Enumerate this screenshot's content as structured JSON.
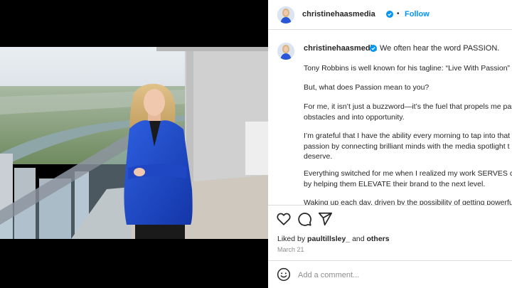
{
  "header": {
    "username": "christinehaasmedia",
    "dot": "•",
    "follow_label": "Follow"
  },
  "caption": {
    "username": "christinehaasmedia",
    "first_line": "We often hear the word PASSION.",
    "paragraphs": [
      [
        "Tony Robbins is well known for his tagline: “Live With Passion”"
      ],
      [
        "But, what does Passion mean to you?"
      ],
      [
        "For me, it isn’t just a buzzword—it’s the fuel that propels me pas",
        "obstacles and into opportunity."
      ],
      [
        "I’m grateful that I have the ability every morning to tap into that",
        "passion by connecting brilliant minds with the media spotlight t",
        "deserve."
      ],
      [
        "Everything switched for me when I realized my work SERVES clie",
        "by helping them ELEVATE their brand to the next level."
      ],
      [
        "Waking up each day, driven by the possibility of getting powerfu"
      ]
    ]
  },
  "likes": {
    "prefix": "Liked by",
    "user": "paultillsley_",
    "joiner": "and",
    "others": "others"
  },
  "date": "March 21",
  "comment": {
    "placeholder": "Add a comment..."
  },
  "icons": {
    "like": "heart-icon",
    "comment": "comment-icon",
    "share": "share-icon",
    "emoji": "emoji-icon",
    "verified": "verified-badge-icon"
  },
  "colors": {
    "link_blue": "#0095f6",
    "verified_blue": "#0095f6",
    "text": "#262626",
    "muted": "#8e8e8e",
    "divider": "#dbdbdb"
  }
}
